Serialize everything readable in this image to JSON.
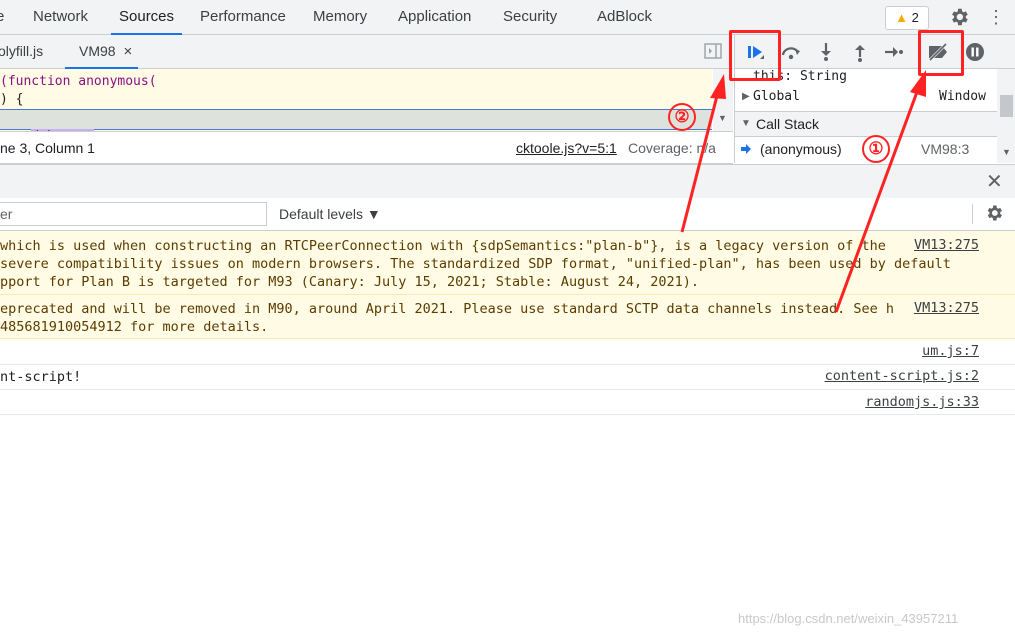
{
  "devtools_tabs": [
    {
      "label": "e"
    },
    {
      "label": "Network"
    },
    {
      "label": "Sources"
    },
    {
      "label": "Performance"
    },
    {
      "label": "Memory"
    },
    {
      "label": "Application"
    },
    {
      "label": "Security"
    },
    {
      "label": "AdBlock"
    }
  ],
  "active_tab": "Sources",
  "warning_count": "2",
  "file_tabs": [
    {
      "label": "olyfill.js"
    },
    {
      "label": "VM98"
    }
  ],
  "file_tab_close": "×",
  "code_lines": [
    "(function anonymous(",
    ") {",
    "debugger"
  ],
  "status": {
    "position": "ne 3, Column 1",
    "source_link": "cktoole.js?v=5:1",
    "coverage": "Coverage: n/a"
  },
  "scope": {
    "this_label": "this: String",
    "global_label": "Global",
    "global_value": "Window"
  },
  "call_stack": {
    "header": "Call Stack",
    "frame_name": "(anonymous)",
    "frame_location": "VM98:3"
  },
  "console": {
    "filter_placeholder": "er",
    "levels_label": "Default levels ▼",
    "messages": [
      {
        "lines": [
          "which is used when constructing an RTCPeerConnection with {sdpSemantics:\"plan-b\"}, is a legacy version of the",
          "severe compatibility issues on modern browsers. The standardized SDP format, \"unified-plan\", has been used by default",
          "pport for Plan B is targeted for M93 (Canary: July 15, 2021; Stable: August 24, 2021)."
        ],
        "source": "VM13:275"
      },
      {
        "lines": [
          "eprecated and will be removed in M90, around April 2021. Please use standard SCTP data channels instead. See h",
          "485681910054912 for more details."
        ],
        "source": "VM13:275"
      },
      {
        "lines": [
          ""
        ],
        "source": "um.js:7"
      },
      {
        "lines": [
          "nt-script!"
        ],
        "source": "content-script.js:2"
      },
      {
        "lines": [
          ""
        ],
        "source": "randomjs.js:33"
      }
    ]
  },
  "annotations": {
    "marker_1": "①",
    "marker_2": "②"
  },
  "watermark": "https://blog.csdn.net/weixin_43957211",
  "colors": {
    "accent": "#1a73e8",
    "annotation_red": "#ff2222",
    "warning_bg": "#fffbe5"
  }
}
